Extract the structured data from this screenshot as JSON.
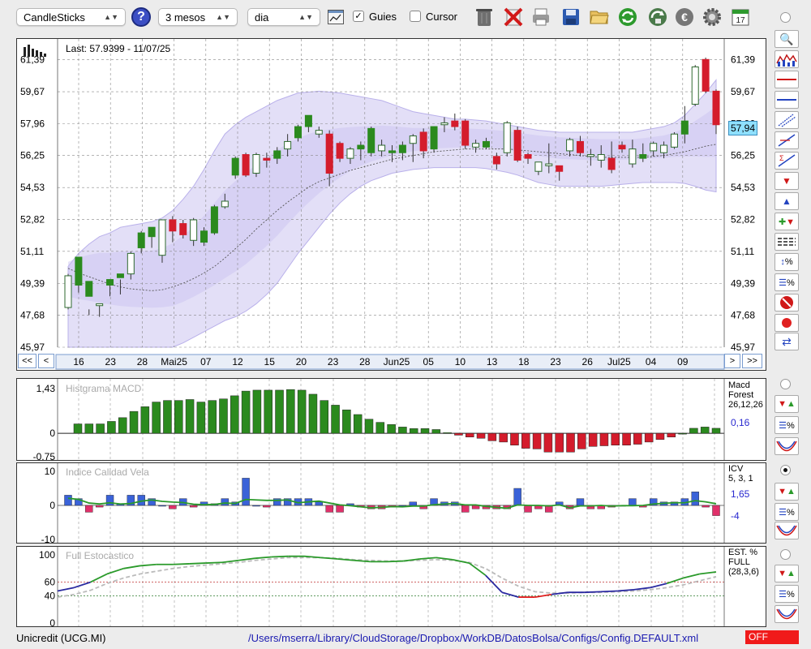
{
  "toolbar": {
    "chart_type": "CandleSticks",
    "period": "3 mesos",
    "interval": "dia",
    "guides_label": "Guies",
    "guides_checked": true,
    "cursor_label": "Cursor",
    "cursor_checked": false,
    "icons": [
      "help-icon",
      "chart-window-icon",
      "trash-icon",
      "delete-icon",
      "print-icon",
      "save-icon",
      "open-folder-icon",
      "refresh-icon",
      "recycle-icon",
      "euro-icon",
      "gear-icon",
      "calendar-icon"
    ],
    "calendar_day": "17"
  },
  "main_chart": {
    "last_label": "Last: 57.9399 - 11/07/25",
    "y_ticks": [
      "61,39",
      "59,67",
      "57,96",
      "56,25",
      "54,53",
      "52,82",
      "51,11",
      "49,39",
      "47,68",
      "45,97"
    ],
    "current_value": "57,94",
    "nav_left": [
      "<<",
      "<"
    ],
    "nav_right": [
      ">",
      ">>"
    ]
  },
  "macd_panel": {
    "title": "Histgrama MACD",
    "y_ticks": [
      "1,43",
      "0",
      "-0,75"
    ],
    "side_label": [
      "Macd",
      "Forest",
      "26,12,26"
    ],
    "value": "0,16"
  },
  "icv_panel": {
    "title": "Indice Calidad Vela",
    "y_ticks": [
      "10",
      "0",
      "-10"
    ],
    "side_label": [
      "ICV",
      "5, 3, 1"
    ],
    "value_pos": "1,65",
    "value_neg": "-4"
  },
  "stoch_panel": {
    "title": "Full Estocastico",
    "y_ticks": [
      "100",
      "60",
      "40",
      "0"
    ],
    "side_label": [
      "EST. %",
      "FULL",
      "(28,3,6)"
    ]
  },
  "status": {
    "ticker": "Unicredit (UCG.MI)",
    "path": "/Users/mserra/Library/CloudStorage/Dropbox/WorkDB/DatosBolsa/Configs/Config.DEFAULT.xml",
    "mode": "OFF"
  },
  "colors": {
    "up": "#2b8a1e",
    "down": "#d41c2c",
    "icv_pos": "#3a62d8",
    "icv_neg": "#e0306a",
    "band": "#d9d4f4",
    "accent": "#7ab8e8"
  },
  "chart_data": [
    {
      "type": "candlestick",
      "x_tick_labels": [
        "16",
        "23",
        "28",
        "Mai25",
        "07",
        "12",
        "15",
        "20",
        "23",
        "28",
        "Jun25",
        "05",
        "10",
        "13",
        "18",
        "23",
        "26",
        "Jul25",
        "04",
        "09"
      ],
      "ylim": [
        45.97,
        62.5
      ],
      "candles": [
        [
          48.1,
          49.8,
          48.0,
          49.9
        ],
        [
          49.3,
          50.8,
          48.9,
          49.9
        ],
        [
          48.7,
          49.5,
          47.7,
          48.0
        ],
        [
          48.2,
          48.3,
          47.6,
          48.3
        ],
        [
          49.3,
          49.6,
          48.7,
          49.6
        ],
        [
          49.7,
          49.9,
          48.8,
          49.6
        ],
        [
          49.9,
          51.0,
          49.6,
          51.1
        ],
        [
          51.3,
          52.1,
          51.0,
          52.2
        ],
        [
          51.9,
          52.4,
          51.3,
          51.9
        ],
        [
          50.9,
          52.8,
          50.5,
          52.8
        ],
        [
          52.8,
          52.2,
          51.6,
          53.0
        ],
        [
          52.6,
          52.0,
          51.8,
          52.8
        ],
        [
          52.8,
          51.7,
          51.4,
          52.9
        ],
        [
          51.6,
          52.2,
          51.4,
          52.4
        ],
        [
          52.1,
          53.5,
          52.0,
          53.6
        ],
        [
          53.5,
          53.8,
          53.4,
          54.2
        ],
        [
          55.2,
          56.1,
          55.0,
          56.2
        ],
        [
          56.3,
          55.2,
          55.1,
          56.4
        ],
        [
          55.3,
          56.3,
          55.1,
          56.4
        ],
        [
          56.1,
          56.0,
          55.6,
          56.4
        ],
        [
          56.1,
          56.5,
          55.8,
          56.7
        ],
        [
          56.6,
          57.0,
          56.2,
          57.4
        ],
        [
          57.2,
          57.8,
          57.0,
          57.9
        ],
        [
          57.8,
          58.4,
          57.5,
          58.4
        ],
        [
          57.6,
          57.4,
          57.2,
          57.8
        ],
        [
          57.4,
          55.3,
          54.6,
          57.6
        ],
        [
          56.9,
          56.1,
          55.9,
          57.0
        ],
        [
          56.6,
          56.1,
          55.8,
          56.7
        ],
        [
          56.6,
          56.8,
          56.0,
          57.0
        ],
        [
          56.4,
          57.7,
          56.2,
          57.8
        ],
        [
          56.8,
          56.5,
          56.2,
          57.1
        ],
        [
          56.4,
          56.5,
          55.9,
          56.8
        ],
        [
          56.4,
          56.8,
          56.0,
          57.0
        ],
        [
          56.9,
          57.3,
          55.9,
          57.4
        ],
        [
          57.5,
          56.5,
          56.1,
          57.7
        ],
        [
          56.6,
          57.8,
          56.4,
          57.8
        ],
        [
          57.9,
          58.0,
          57.5,
          58.3
        ],
        [
          58.1,
          57.8,
          57.6,
          58.5
        ],
        [
          58.1,
          56.8,
          56.6,
          58.2
        ],
        [
          56.7,
          56.9,
          56.4,
          57.1
        ],
        [
          56.7,
          57.0,
          56.6,
          57.2
        ],
        [
          56.2,
          55.8,
          55.5,
          56.4
        ],
        [
          56.4,
          58.0,
          56.2,
          58.1
        ],
        [
          57.6,
          56.0,
          55.9,
          57.8
        ],
        [
          56.3,
          56.1,
          55.8,
          56.4
        ],
        [
          55.9,
          55.4,
          55.2,
          55.9
        ],
        [
          55.7,
          55.8,
          55.3,
          56.9
        ],
        [
          55.7,
          55.4,
          54.9,
          55.7
        ],
        [
          56.5,
          57.1,
          56.2,
          57.2
        ],
        [
          57.0,
          56.4,
          56.2,
          57.3
        ],
        [
          56.2,
          56.3,
          55.7,
          56.6
        ],
        [
          56.3,
          56.0,
          55.6,
          56.8
        ],
        [
          56.1,
          55.5,
          55.3,
          57.0
        ],
        [
          56.8,
          56.6,
          56.4,
          57.0
        ],
        [
          56.6,
          55.8,
          55.6,
          57.1
        ],
        [
          56.1,
          56.3,
          55.9,
          56.9
        ],
        [
          56.5,
          56.9,
          56.2,
          57.0
        ],
        [
          56.4,
          56.8,
          56.1,
          57.0
        ],
        [
          56.7,
          57.4,
          56.6,
          57.5
        ],
        [
          57.4,
          58.1,
          56.9,
          58.9
        ],
        [
          59.0,
          61.0,
          58.9,
          61.1
        ],
        [
          61.4,
          59.7,
          59.6,
          61.5
        ],
        [
          59.7,
          57.9,
          57.4,
          59.8
        ]
      ],
      "sma": [
        50.2,
        49.95,
        49.75,
        49.55,
        49.35,
        49.2,
        49.1,
        49.05,
        49.0,
        49.05,
        49.2,
        49.4,
        49.65,
        49.95,
        50.3,
        50.75,
        51.25,
        51.75,
        52.3,
        52.8,
        53.3,
        53.75,
        54.15,
        54.55,
        54.85,
        55.05,
        55.25,
        55.45,
        55.6,
        55.75,
        55.9,
        56.05,
        56.15,
        56.25,
        56.35,
        56.45,
        56.5,
        56.55,
        56.6,
        56.6,
        56.6,
        56.6,
        56.6,
        56.55,
        56.5,
        56.45,
        56.4,
        56.35,
        56.3,
        56.25,
        56.2,
        56.15,
        56.15,
        56.15,
        56.15,
        56.15,
        56.2,
        56.25,
        56.35,
        56.45,
        56.6,
        56.75,
        56.85
      ],
      "band_upper": [
        50.3,
        51.0,
        51.5,
        51.9,
        52.1,
        52.4,
        52.5,
        52.6,
        52.7,
        52.9,
        53.3,
        53.9,
        54.6,
        55.5,
        56.5,
        57.4,
        57.9,
        58.3,
        58.6,
        58.9,
        59.2,
        59.4,
        59.6,
        59.65,
        59.7,
        59.65,
        59.6,
        59.5,
        59.4,
        59.3,
        59.2,
        59.0,
        58.8,
        58.6,
        58.5,
        58.4,
        58.3,
        58.2,
        58.2,
        58.15,
        58.1,
        58.0,
        57.9,
        57.8,
        57.7,
        57.6,
        57.55,
        57.5,
        57.5,
        57.5,
        57.5,
        57.5,
        57.5,
        57.5,
        57.5,
        57.6,
        57.7,
        57.8,
        58.0,
        58.4,
        59.0,
        59.6,
        60.3
      ],
      "band_lower": [
        45.97,
        45.97,
        45.97,
        45.97,
        45.97,
        45.97,
        45.97,
        45.97,
        45.97,
        45.97,
        45.97,
        46.2,
        46.5,
        46.8,
        47.1,
        47.4,
        47.6,
        47.9,
        48.3,
        48.8,
        49.4,
        50.2,
        51.0,
        51.7,
        52.4,
        53.1,
        53.7,
        54.2,
        54.6,
        54.9,
        55.1,
        55.3,
        55.4,
        55.5,
        55.55,
        55.6,
        55.6,
        55.6,
        55.6,
        55.6,
        55.55,
        55.45,
        55.35,
        55.2,
        55.0,
        54.8,
        54.7,
        54.6,
        54.6,
        54.6,
        54.6,
        54.6,
        54.65,
        54.7,
        54.75,
        54.8,
        54.8,
        54.8,
        54.8,
        54.75,
        54.6,
        54.4,
        54.3
      ]
    },
    {
      "type": "bar",
      "name": "Histgrama MACD",
      "ylim": [
        -0.75,
        1.43
      ],
      "values": [
        0.3,
        0.3,
        0.3,
        0.38,
        0.5,
        0.7,
        0.85,
        1.0,
        1.05,
        1.05,
        1.08,
        1.0,
        1.05,
        1.1,
        1.2,
        1.35,
        1.38,
        1.38,
        1.38,
        1.4,
        1.38,
        1.25,
        1.05,
        0.9,
        0.75,
        0.6,
        0.45,
        0.35,
        0.28,
        0.2,
        0.15,
        0.15,
        0.12,
        0.02,
        -0.06,
        -0.12,
        -0.16,
        -0.24,
        -0.28,
        -0.38,
        -0.48,
        -0.5,
        -0.6,
        -0.6,
        -0.6,
        -0.5,
        -0.42,
        -0.4,
        -0.38,
        -0.38,
        -0.35,
        -0.28,
        -0.2,
        -0.12,
        0.0,
        0.16,
        0.2,
        0.16
      ]
    },
    {
      "type": "bar",
      "name": "Indice Calidad Vela",
      "ylim": [
        -10,
        10
      ],
      "values": [
        3,
        2,
        -2,
        -0.5,
        3,
        0.5,
        3,
        3,
        2,
        0,
        -1,
        2,
        -0.5,
        1,
        0.5,
        2,
        1,
        8,
        0,
        -0.5,
        2,
        2,
        2,
        2,
        1,
        -2,
        -2,
        0.5,
        -0.5,
        -1,
        -1,
        -0.5,
        0,
        1,
        -1,
        2,
        1,
        1,
        -2,
        -1,
        -1,
        -1,
        -1,
        5,
        -2,
        -1,
        -2,
        1,
        -1,
        2,
        -1,
        -1,
        -0.5,
        0,
        2,
        -0.5,
        2,
        1,
        1,
        2,
        4,
        -0.5,
        -3
      ]
    },
    {
      "type": "line",
      "name": "Full Estocastico",
      "ylim": [
        0,
        100
      ],
      "series": [
        {
          "values": [
            47,
            52,
            60,
            72,
            80,
            84,
            86,
            86,
            87,
            88,
            89,
            92,
            95,
            97,
            98,
            98,
            96,
            94,
            92,
            90,
            90,
            91,
            94,
            96,
            93,
            88,
            70,
            45,
            38,
            38,
            42,
            45,
            45,
            46,
            47,
            49,
            52,
            58,
            66,
            72,
            75
          ]
        },
        {
          "values": [
            38,
            42,
            48,
            58,
            66,
            72,
            76,
            80,
            83,
            85,
            87,
            89,
            92,
            94,
            96,
            96,
            96,
            95,
            93,
            92,
            91,
            91,
            92,
            93,
            92,
            89,
            80,
            66,
            54,
            46,
            44,
            44,
            45,
            45,
            46,
            47,
            49,
            52,
            56,
            62,
            68
          ]
        }
      ]
    }
  ]
}
